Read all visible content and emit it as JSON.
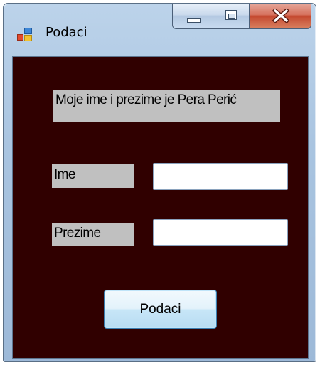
{
  "window": {
    "title": "Podaci",
    "icon": "windows-form-icon"
  },
  "caption_buttons": {
    "minimize_icon": "minimize-icon",
    "maximize_icon": "maximize-icon",
    "close_icon": "close-icon"
  },
  "form": {
    "background_color": "#300000",
    "info_label": "Moje ime i prezime je Pera Perić",
    "first_name_label": "Ime",
    "first_name_value": "",
    "last_name_label": "Prezime",
    "last_name_value": "",
    "submit_button": "Podaci"
  }
}
